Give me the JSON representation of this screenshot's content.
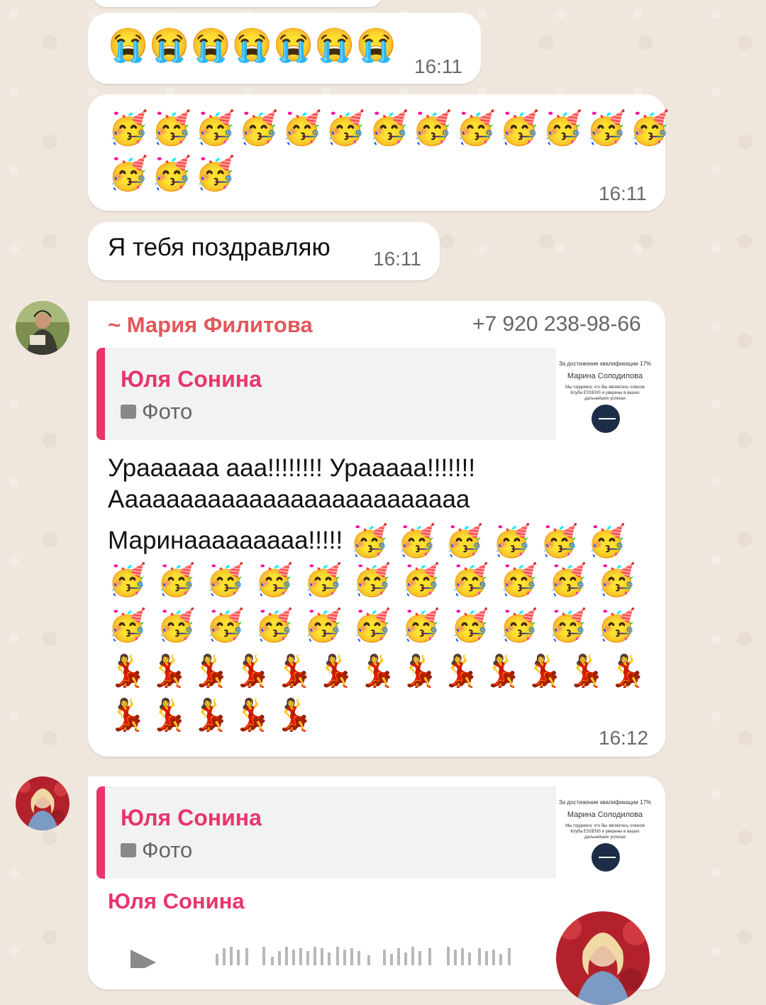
{
  "messages": {
    "m1": {
      "emojis": "😭😭😭😭😭😭😭",
      "time": "16:11"
    },
    "m2": {
      "emojis_line1": "🥳🥳🥳🥳🥳🥳🥳🥳🥳🥳🥳🥳🥳",
      "emojis_line2": "🥳🥳🥳",
      "time": "16:11"
    },
    "m3": {
      "text": "Я тебя поздравляю",
      "time": "16:11"
    },
    "m4": {
      "sender": "~ Мария Филитова",
      "phone": "+7 920 238-98-66",
      "quote": {
        "author": "Юля Сонина",
        "kind": "Фото",
        "thumb": {
          "title": "За достижение квалификации 17%",
          "name": "Марина Солодилова",
          "body": "Мы гордимся, что Вы являетесь членом Клуба ESSENS и уверены в ваших дальнейших успехах"
        }
      },
      "line1": "Ураааааа ааа!!!!!!!! Урааааа!!!!!!!",
      "line2": "Аааааааааааааааааааааааааа",
      "line3": "Маринааааааааа!!!!!",
      "line3_emojis": "🥳 🥳 🥳 🥳 🥳 🥳",
      "emoji_row1": "🥳 🥳 🥳 🥳 🥳 🥳 🥳 🥳 🥳 🥳 🥳",
      "emoji_row2": "🥳 🥳 🥳 🥳 🥳 🥳 🥳 🥳 🥳 🥳 🥳",
      "emoji_row3": "💃💃💃💃💃💃💃💃💃💃💃💃💃",
      "emoji_row4": "💃💃💃💃💃",
      "time": "16:12"
    },
    "m5": {
      "quote": {
        "author": "Юля Сонина",
        "kind": "Фото",
        "thumb": {
          "title": "За достижение квалификации 17%",
          "name": "Марина Солодилова",
          "body": "Мы гордимся, что Вы являетесь членом Клуба ESSENS и уверены в ваших дальнейших успехах"
        }
      },
      "sender": "Юля Сонина"
    }
  },
  "icons": {
    "photo": "photo-icon",
    "play": "play-icon"
  }
}
